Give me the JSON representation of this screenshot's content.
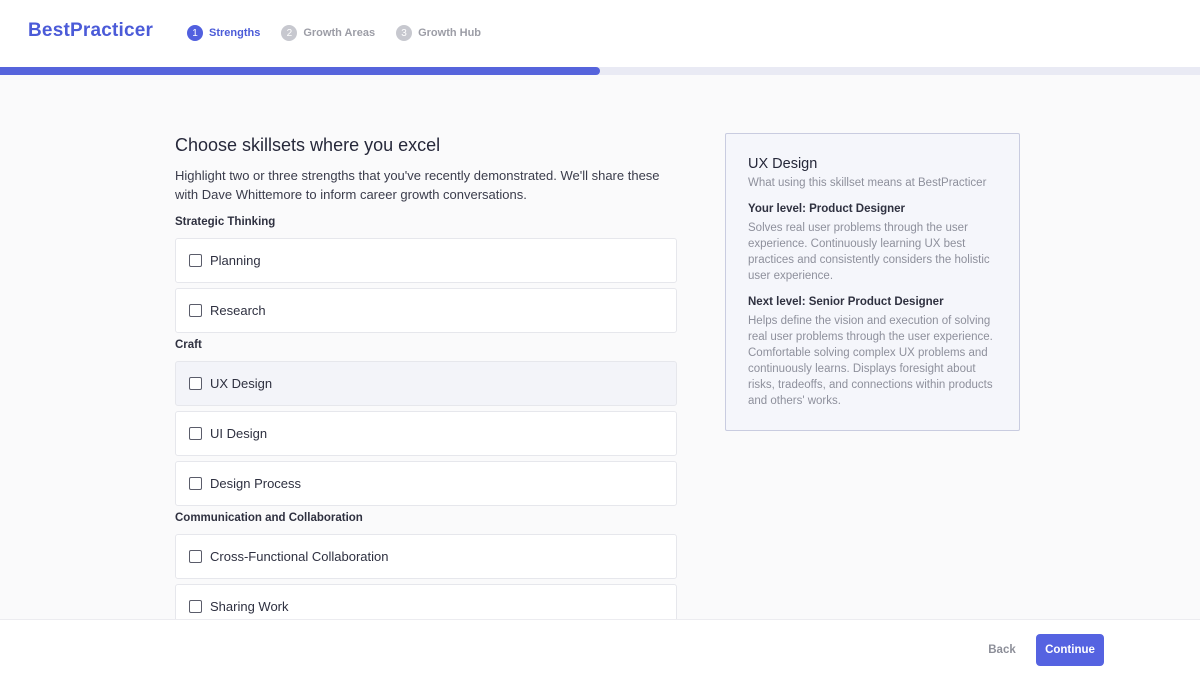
{
  "header": {
    "logo": "BestPracticer",
    "steps": [
      {
        "number": "1",
        "label": "Strengths",
        "active": true
      },
      {
        "number": "2",
        "label": "Growth Areas",
        "active": false
      },
      {
        "number": "3",
        "label": "Growth Hub",
        "active": false
      }
    ],
    "progress_percent": 50
  },
  "main": {
    "title": "Choose skillsets where you excel",
    "description": "Highlight two or three strengths that you've recently demonstrated. We'll share these with Dave Whittemore to inform career growth conversations.",
    "groups": [
      {
        "label": "Strategic Thinking",
        "options": [
          "Planning",
          "Research"
        ]
      },
      {
        "label": "Craft",
        "options": [
          "UX Design",
          "UI Design",
          "Design Process"
        ]
      },
      {
        "label": "Communication and Collaboration",
        "options": [
          "Cross-Functional Collaboration",
          "Sharing Work"
        ]
      }
    ]
  },
  "detail": {
    "title": "UX Design",
    "subtitle": "What using this skillset means at BestPracticer",
    "current_heading": "Your level: Product Designer",
    "current_text": "Solves real user problems through the user experience. Continuously learning UX best practices and consistently considers the holistic user experience.",
    "next_heading": "Next level: Senior Product Designer",
    "next_text": "Helps define the vision and execution of solving real user problems through the user experience. Comfortable solving complex UX problems and continuously learns. Displays foresight about risks, tradeoffs, and connections within products and others' works."
  },
  "footer": {
    "back_label": "Back",
    "continue_label": "Continue"
  },
  "colors": {
    "accent": "#5563e1",
    "brand": "#4b5bd8"
  }
}
